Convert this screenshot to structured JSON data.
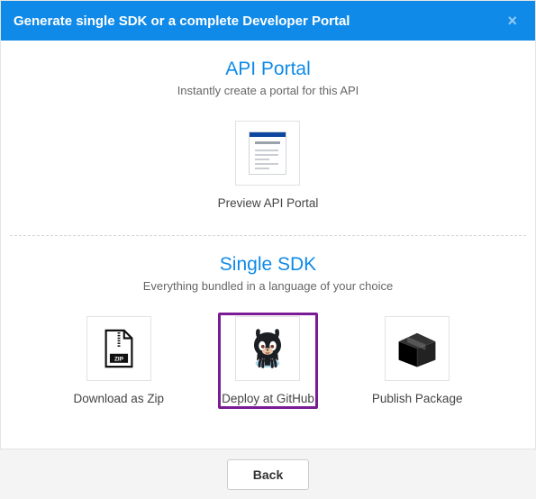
{
  "header": {
    "title": "Generate single SDK or a complete Developer Portal"
  },
  "portal": {
    "heading": "API Portal",
    "sub": "Instantly create a portal for this API",
    "preview_label": "Preview API Portal"
  },
  "sdk": {
    "heading": "Single SDK",
    "sub": "Everything bundled in a language of your choice",
    "zip_label": "Download as Zip",
    "github_label": "Deploy at GitHub",
    "publish_label": "Publish Package"
  },
  "footer": {
    "back_label": "Back"
  }
}
